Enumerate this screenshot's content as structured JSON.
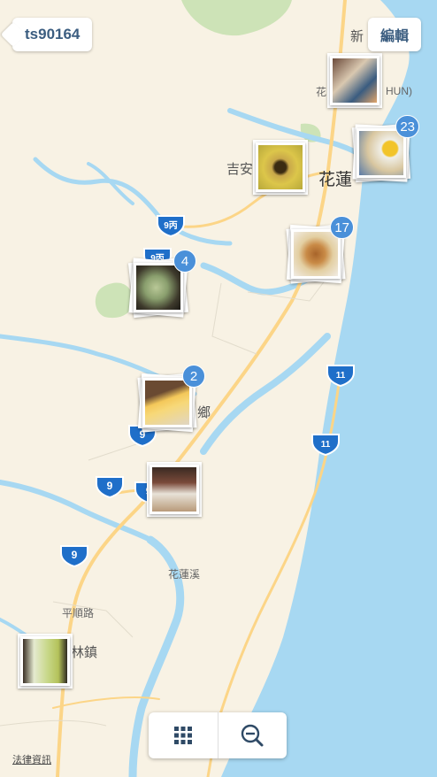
{
  "header": {
    "back_label": "ts90164",
    "edit_label": "編輯"
  },
  "map": {
    "place_labels": [
      {
        "text": "新",
        "kind": "town"
      },
      {
        "text": "吉安",
        "kind": "town"
      },
      {
        "text": "花蓮",
        "kind": "city"
      },
      {
        "text": "鄉",
        "kind": "town"
      },
      {
        "text": "花蓮溪",
        "kind": "river"
      },
      {
        "text": "平順路",
        "kind": "road"
      },
      {
        "text": "林鎮",
        "kind": "town"
      },
      {
        "text": "HUN)",
        "kind": "town"
      },
      {
        "text": "花",
        "kind": "town"
      }
    ],
    "route_shields": [
      "9丙",
      "9丙",
      "9",
      "9",
      "9",
      "9",
      "11",
      "11"
    ],
    "photo_clusters": [
      {
        "count": "",
        "photo": "market-stall-photo"
      },
      {
        "count": "23",
        "photo": "shaved-ice-photo"
      },
      {
        "count": "",
        "photo": "papaya-photo"
      },
      {
        "count": "17",
        "photo": "sandwich-photo"
      },
      {
        "count": "4",
        "photo": "dumplings-photo"
      },
      {
        "count": "2",
        "photo": "cheesecake-photo"
      },
      {
        "count": "",
        "photo": "dessert-shop-photo"
      },
      {
        "count": "",
        "photo": "drinks-photo"
      }
    ],
    "colors": {
      "land": "#f8f2e4",
      "water": "#a7d8f2",
      "road": "#fcd587",
      "park": "#cde3b7",
      "badge": "#4a90d9"
    }
  },
  "toolbar": {
    "grid_icon": "grid-icon",
    "zoom_out_icon": "zoom-out-icon"
  },
  "legal_label": "法律資訊"
}
